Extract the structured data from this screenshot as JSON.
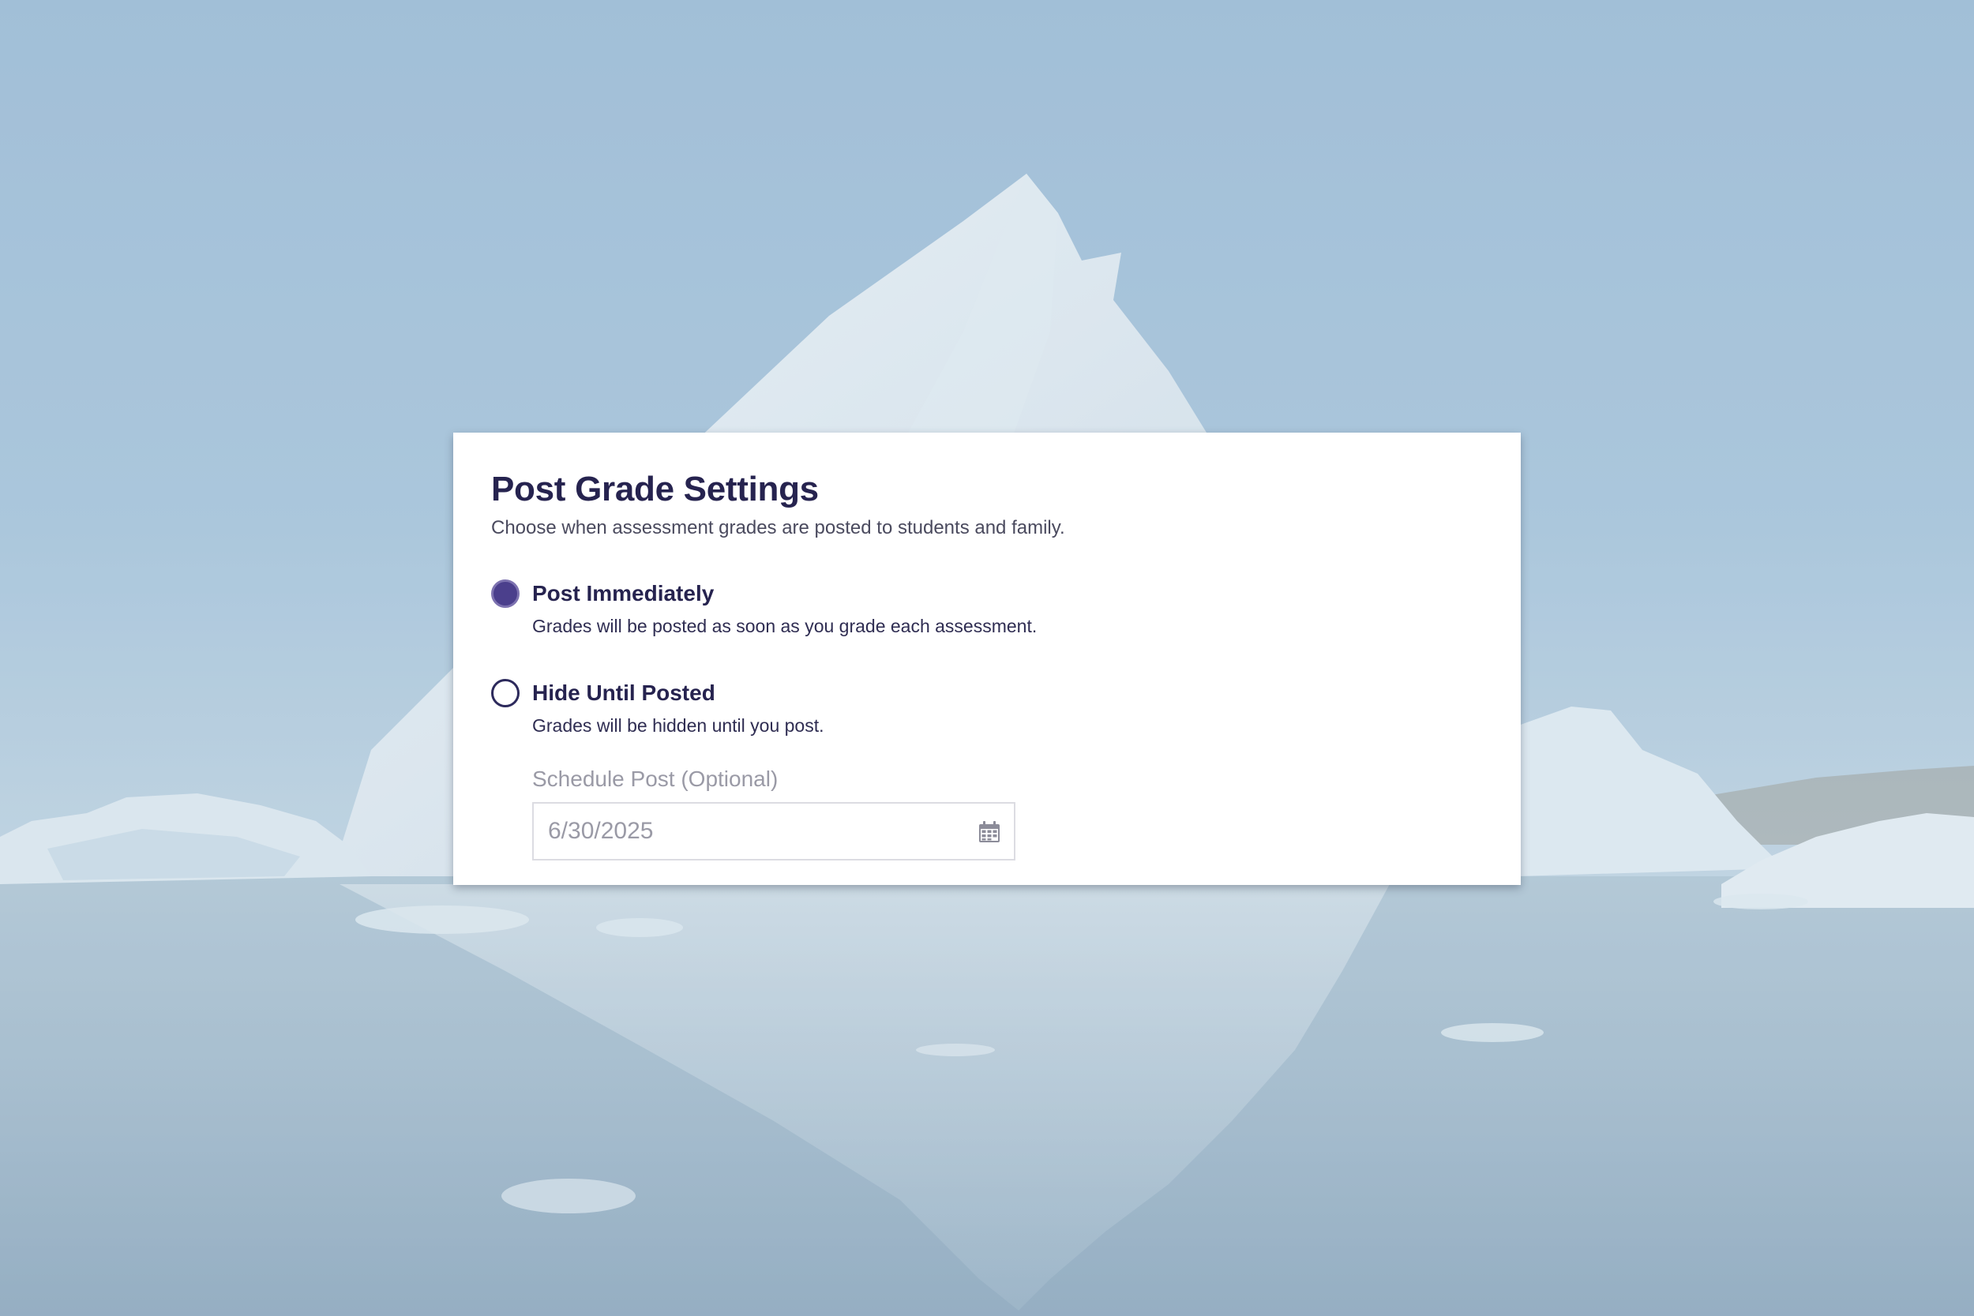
{
  "dialog": {
    "title": "Post Grade Settings",
    "subtitle": "Choose when assessment grades are posted to students and family.",
    "options": [
      {
        "label": "Post Immediately",
        "description": "Grades will be posted as soon as you grade each assessment.",
        "selected": true
      },
      {
        "label": "Hide Until Posted",
        "description": "Grades will be hidden until you post.",
        "selected": false
      }
    ],
    "schedule": {
      "label": "Schedule Post (Optional)",
      "value": "6/30/2025",
      "icon": "calendar-icon"
    }
  },
  "colors": {
    "accent": "#4b3f8c",
    "title": "#26234f",
    "muted": "#9a9aa6"
  }
}
